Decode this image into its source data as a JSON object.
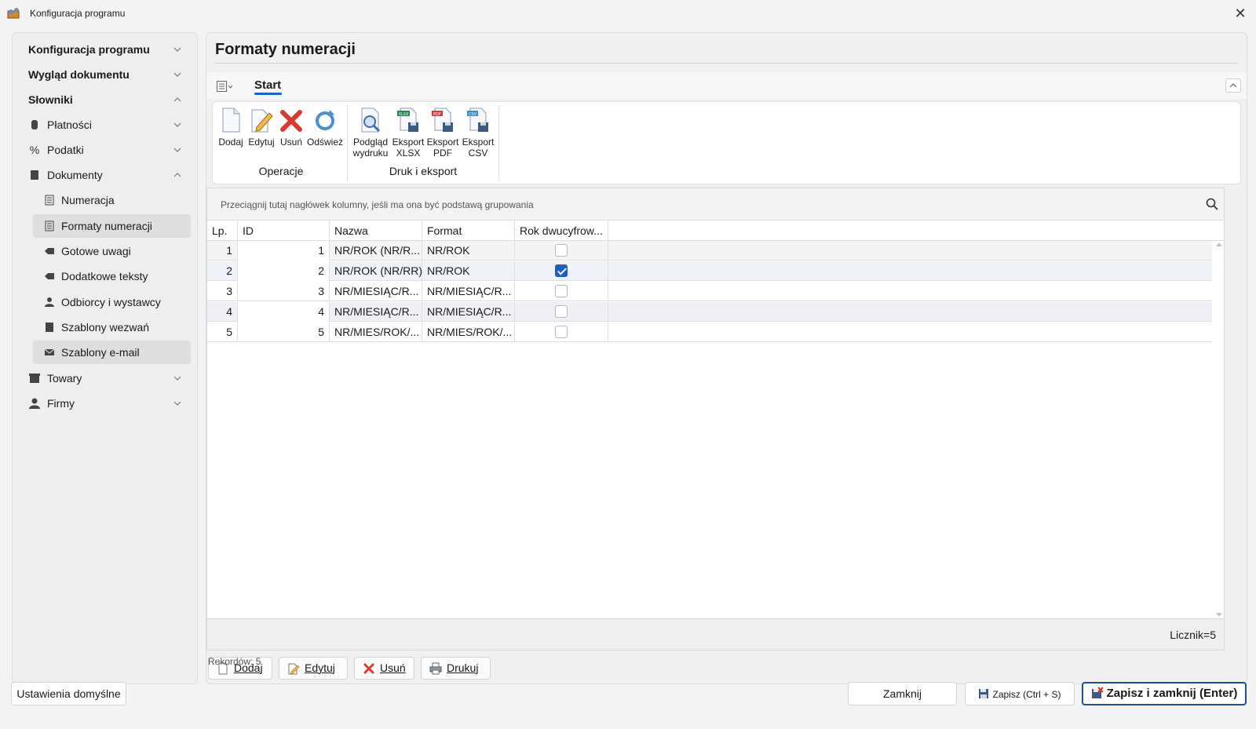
{
  "window": {
    "title": "Konfiguracja programu"
  },
  "sidebar": {
    "items": [
      {
        "label": "Konfiguracja programu"
      },
      {
        "label": "Wygląd dokumentu"
      },
      {
        "label": "Słowniki"
      },
      {
        "label": "Płatności"
      },
      {
        "label": "Podatki"
      },
      {
        "label": "Dokumenty"
      },
      {
        "label": "Numeracja"
      },
      {
        "label": "Formaty numeracji"
      },
      {
        "label": "Gotowe uwagi"
      },
      {
        "label": "Dodatkowe teksty"
      },
      {
        "label": "Odbiorcy i wystawcy"
      },
      {
        "label": "Szablony wezwań"
      },
      {
        "label": "Szablony e-mail"
      },
      {
        "label": "Towary"
      },
      {
        "label": "Firmy"
      }
    ]
  },
  "main": {
    "title": "Formaty numeracji",
    "ribbon": {
      "tab": "Start",
      "buttons": {
        "add": "Dodaj",
        "edit": "Edytuj",
        "delete": "Usuń",
        "refresh": "Odśwież",
        "preview_l1": "Podgląd",
        "preview_l2": "wydruku",
        "xlsx_l1": "Eksport",
        "xlsx_l2": "XLSX",
        "pdf_l1": "Eksport",
        "pdf_l2": "PDF",
        "csv_l1": "Eksport",
        "csv_l2": "CSV"
      },
      "groups": {
        "operations": "Operacje",
        "print": "Druk i eksport"
      }
    },
    "grid": {
      "group_hint": "Przeciągnij tutaj nagłówek kolumny, jeśli ma ona być podstawą grupowania",
      "columns": [
        "Lp.",
        "ID",
        "Nazwa",
        "Format",
        "Rok dwucyfrow..."
      ],
      "rows": [
        {
          "lp": "1",
          "id": "1",
          "name": "NR/ROK (NR/R...",
          "format": "NR/ROK",
          "two_digit_year": false
        },
        {
          "lp": "2",
          "id": "2",
          "name": "NR/ROK (NR/RR)",
          "format": "NR/ROK",
          "two_digit_year": true
        },
        {
          "lp": "3",
          "id": "3",
          "name": "NR/MIESIĄC/R...",
          "format": "NR/MIESIĄC/R...",
          "two_digit_year": false
        },
        {
          "lp": "4",
          "id": "4",
          "name": "NR/MIESIĄC/R...",
          "format": "NR/MIESIĄC/R...",
          "two_digit_year": false
        },
        {
          "lp": "5",
          "id": "5",
          "name": "NR/MIES/ROK/...",
          "format": "NR/MIES/ROK/...",
          "two_digit_year": false
        }
      ],
      "counter": "Licznik=5"
    },
    "bottom_buttons": {
      "add": "Dodaj",
      "edit": "Edytuj",
      "delete": "Usuń",
      "print": "Drukuj"
    },
    "records": "Rekordów: 5"
  },
  "footer": {
    "defaults": "Ustawienia domyślne",
    "close": "Zamknij",
    "save": "Zapisz (Ctrl + S)",
    "save_close": "Zapisz i zamknij (Enter)"
  },
  "colors": {
    "accent": "#1a64c8",
    "checkbox_on": "#1a5fc4",
    "primary_border": "#1a4f9c"
  }
}
